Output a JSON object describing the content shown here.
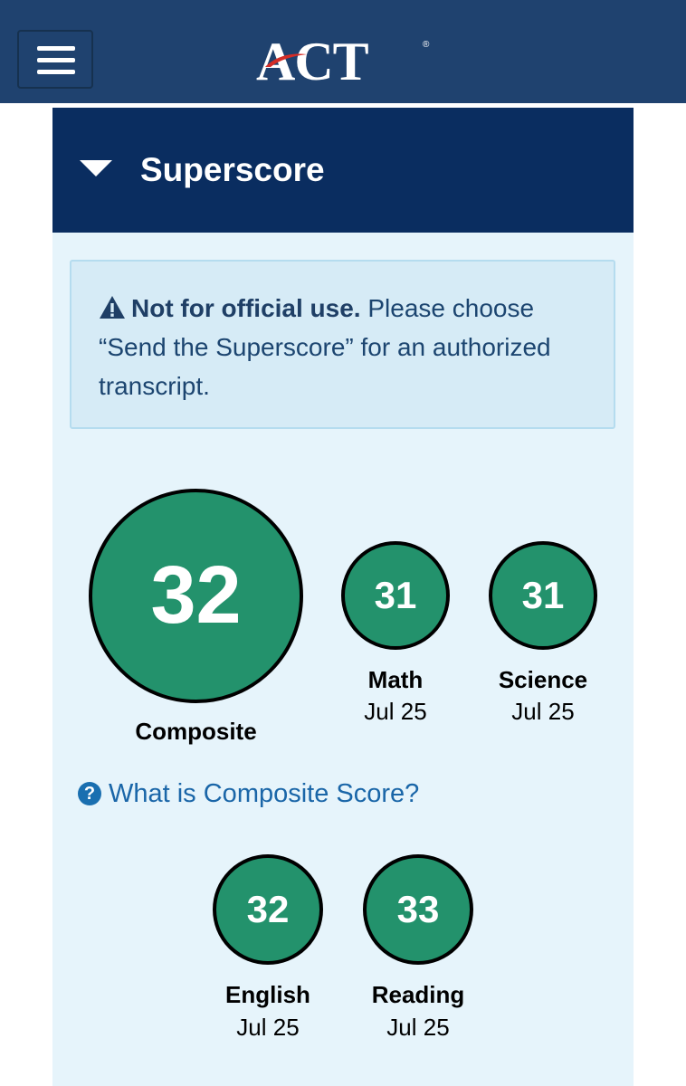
{
  "header": {
    "menu_icon": "hamburger-menu-icon",
    "logo_text": "ACT",
    "logo_mark": "®",
    "background": "#1f426f"
  },
  "panel": {
    "title": "Superscore",
    "expanded_icon": "caret-down-icon",
    "header_color": "#0a2d60"
  },
  "notice": {
    "icon": "warning-triangle-icon",
    "bold_text": "Not for official use.",
    "text": " Please choose “Send the Superscore” for an authorized transcript."
  },
  "composite": {
    "score": "32",
    "label": "Composite"
  },
  "subjects": [
    {
      "score": "31",
      "label": "Math",
      "date": "Jul 25"
    },
    {
      "score": "31",
      "label": "Science",
      "date": "Jul 25"
    },
    {
      "score": "32",
      "label": "English",
      "date": "Jul 25"
    },
    {
      "score": "33",
      "label": "Reading",
      "date": "Jul 25"
    }
  ],
  "help": {
    "icon": "question-circle-icon",
    "link_text": "What is Composite Score?"
  },
  "colors": {
    "score_green": "#23926c",
    "link_blue": "#1a66a8",
    "card_bg": "#e6f4fb"
  }
}
